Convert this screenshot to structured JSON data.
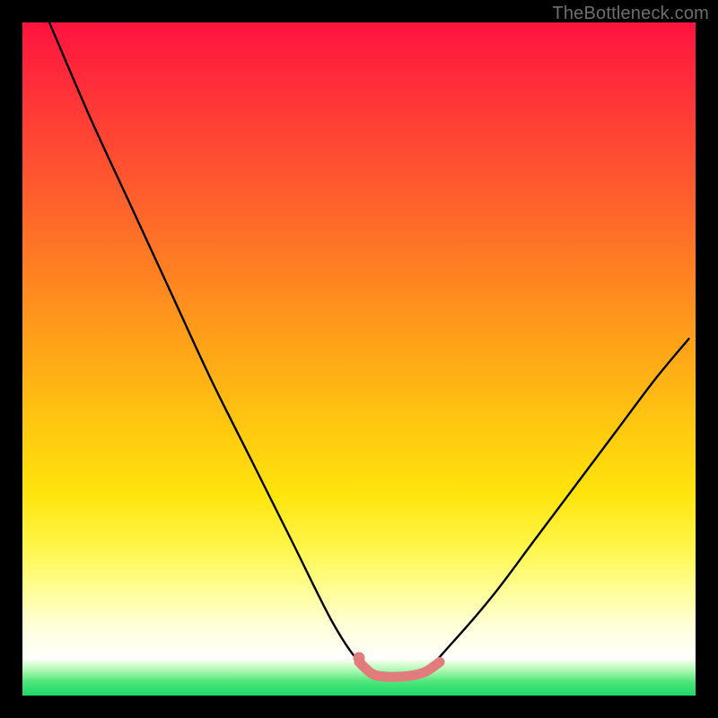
{
  "watermark": "TheBottleneck.com",
  "chart_data": {
    "type": "line",
    "title": "",
    "xlabel": "",
    "ylabel": "",
    "xlim": [
      0,
      100
    ],
    "ylim": [
      0,
      100
    ],
    "grid": false,
    "series": [
      {
        "name": "bottleneck-curve",
        "color": "#000000",
        "x": [
          4,
          10,
          16,
          22,
          28,
          34,
          40,
          46,
          50,
          53,
          56,
          60,
          64,
          70,
          76,
          82,
          88,
          94,
          99
        ],
        "y": [
          100,
          86,
          73,
          60,
          47,
          35,
          23,
          11,
          5,
          3,
          3,
          4,
          8,
          15,
          23,
          31,
          39,
          47,
          53
        ]
      },
      {
        "name": "optimal-range",
        "color": "#e27b7b",
        "x": [
          50,
          52,
          54,
          56,
          58,
          60,
          62
        ],
        "y": [
          5,
          3.2,
          2.8,
          2.8,
          3.0,
          3.6,
          5
        ]
      },
      {
        "name": "optimal-marker-dot",
        "color": "#e27b7b",
        "x": [
          50
        ],
        "y": [
          5.6
        ]
      }
    ]
  },
  "colors": {
    "background": "#000000",
    "curve": "#000000",
    "segment": "#e27b7b",
    "watermark": "#6e6e6e"
  }
}
